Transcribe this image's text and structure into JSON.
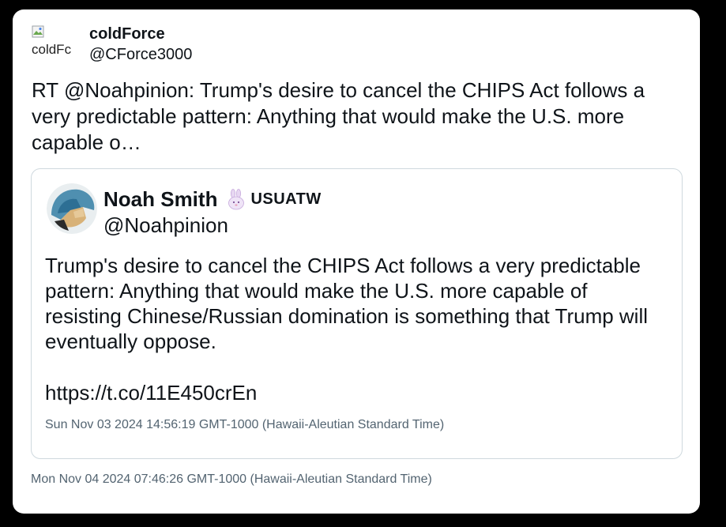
{
  "tweet": {
    "author": {
      "avatar_alt": "coldFc",
      "display_name": "coldForce",
      "handle": "@CForce3000"
    },
    "text": "RT @Noahpinion: Trump's desire to cancel the CHIPS Act follows a very predictable pattern: Anything that would make the U.S. more capable o…",
    "timestamp": "Mon Nov 04 2024 07:46:26 GMT-1000 (Hawaii-Aleutian Standard Time)"
  },
  "quoted_tweet": {
    "author": {
      "display_name": "Noah Smith",
      "badge_icon": "bunny-icon",
      "badge_text": "USUATW",
      "handle": "@Noahpinion"
    },
    "text": "Trump's desire to cancel the CHIPS Act follows a very predictable pattern: Anything that would make the U.S. more capable of resisting Chinese/Russian domination is something that Trump will eventually oppose.",
    "link": "https://t.co/11E450crEn",
    "timestamp": "Sun Nov 03 2024 14:56:19 GMT-1000 (Hawaii-Aleutian Standard Time)"
  },
  "colors": {
    "background": "#000000",
    "card": "#ffffff",
    "text": "#0f1419",
    "muted": "#536471",
    "border": "#cfd9de"
  }
}
